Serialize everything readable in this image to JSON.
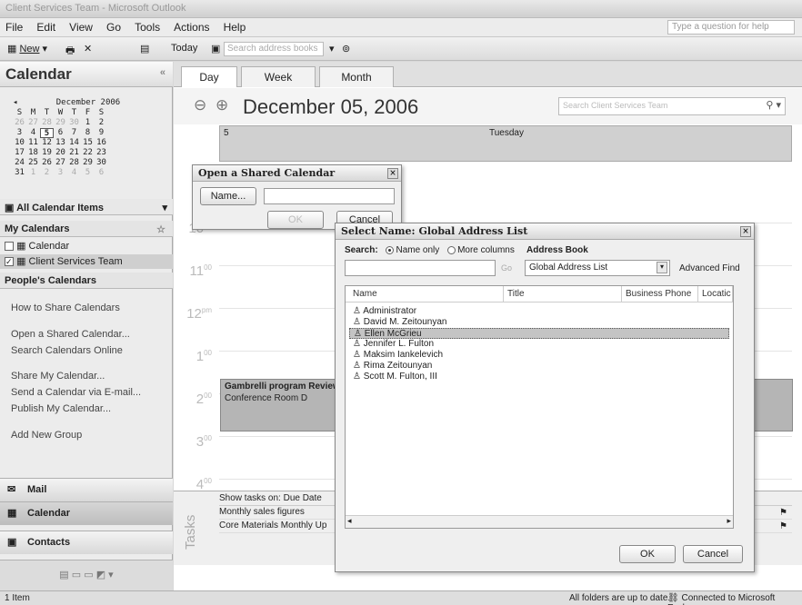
{
  "window": {
    "title": "Client Services Team - Microsoft Outlook"
  },
  "menu": {
    "items": [
      "File",
      "Edit",
      "View",
      "Go",
      "Tools",
      "Actions",
      "Help"
    ],
    "help_placeholder": "Type a question for help"
  },
  "toolbar": {
    "new_label": "New",
    "today_label": "Today",
    "search_placeholder": "Search address books"
  },
  "nav": {
    "title": "Calendar",
    "minical": {
      "month": "December 2006",
      "weekdays": [
        "S",
        "M",
        "T",
        "W",
        "T",
        "F",
        "S"
      ],
      "weeks": [
        [
          "26",
          "27",
          "28",
          "29",
          "30",
          "1",
          "2"
        ],
        [
          "3",
          "4",
          "5",
          "6",
          "7",
          "8",
          "9"
        ],
        [
          "10",
          "11",
          "12",
          "13",
          "14",
          "15",
          "16"
        ],
        [
          "17",
          "18",
          "19",
          "20",
          "21",
          "22",
          "23"
        ],
        [
          "24",
          "25",
          "26",
          "27",
          "28",
          "29",
          "30"
        ],
        [
          "31",
          "1",
          "2",
          "3",
          "4",
          "5",
          "6"
        ]
      ]
    },
    "all_items": "All Calendar Items",
    "my_calendars": "My Calendars",
    "calendars": [
      "Calendar",
      "Client Services Team"
    ],
    "peoples": "People's Calendars",
    "links": [
      "How to Share Calendars",
      "Open a Shared Calendar...",
      "Search Calendars Online",
      "Share My Calendar...",
      "Send a Calendar via E-mail...",
      "Publish My Calendar...",
      "Add New Group"
    ],
    "buttons": [
      "Mail",
      "Calendar",
      "Contacts"
    ]
  },
  "main": {
    "tabs": [
      "Day",
      "Week",
      "Month"
    ],
    "date": "December 05, 2006",
    "search_placeholder": "Search Client Services Team",
    "day_number": "5",
    "day_name": "Tuesday",
    "times": [
      "10",
      "11",
      "12",
      "1",
      "2",
      "3",
      "4"
    ],
    "times_sup": [
      "00",
      "00",
      "pm",
      "00",
      "00",
      "00",
      "00"
    ],
    "appointment": {
      "title": "Gambrelli program Review",
      "location": "Conference Room D"
    },
    "tasks_label": "Tasks",
    "tasks": [
      "Show tasks on: Due Date",
      "Monthly sales figures",
      "Core Materials Monthly Up"
    ]
  },
  "shared_dialog": {
    "title": "Open a Shared Calendar",
    "name_button": "Name...",
    "ok": "OK",
    "cancel": "Cancel"
  },
  "select_dialog": {
    "title": "Select Name: Global Address List",
    "search_label": "Search:",
    "opt_name_only": "Name only",
    "opt_more_columns": "More columns",
    "address_book_label": "Address Book",
    "address_book_value": "Global Address List",
    "go": "Go",
    "advanced_find": "Advanced Find",
    "columns": [
      "Name",
      "Title",
      "Business Phone",
      "Locatic"
    ],
    "people": [
      "Administrator",
      "David M. Zeitounyan",
      "Ellen McGrieu",
      "Jennifer L. Fulton",
      "Maksim Iankelevich",
      "Rima Zeitounyan",
      "Scott M. Fulton, III"
    ],
    "selected_index": 2,
    "ok": "OK",
    "cancel": "Cancel"
  },
  "status": {
    "items": "1 Item",
    "folders": "All folders are up to date.",
    "connection": "Connected to Microsoft Exchange"
  }
}
